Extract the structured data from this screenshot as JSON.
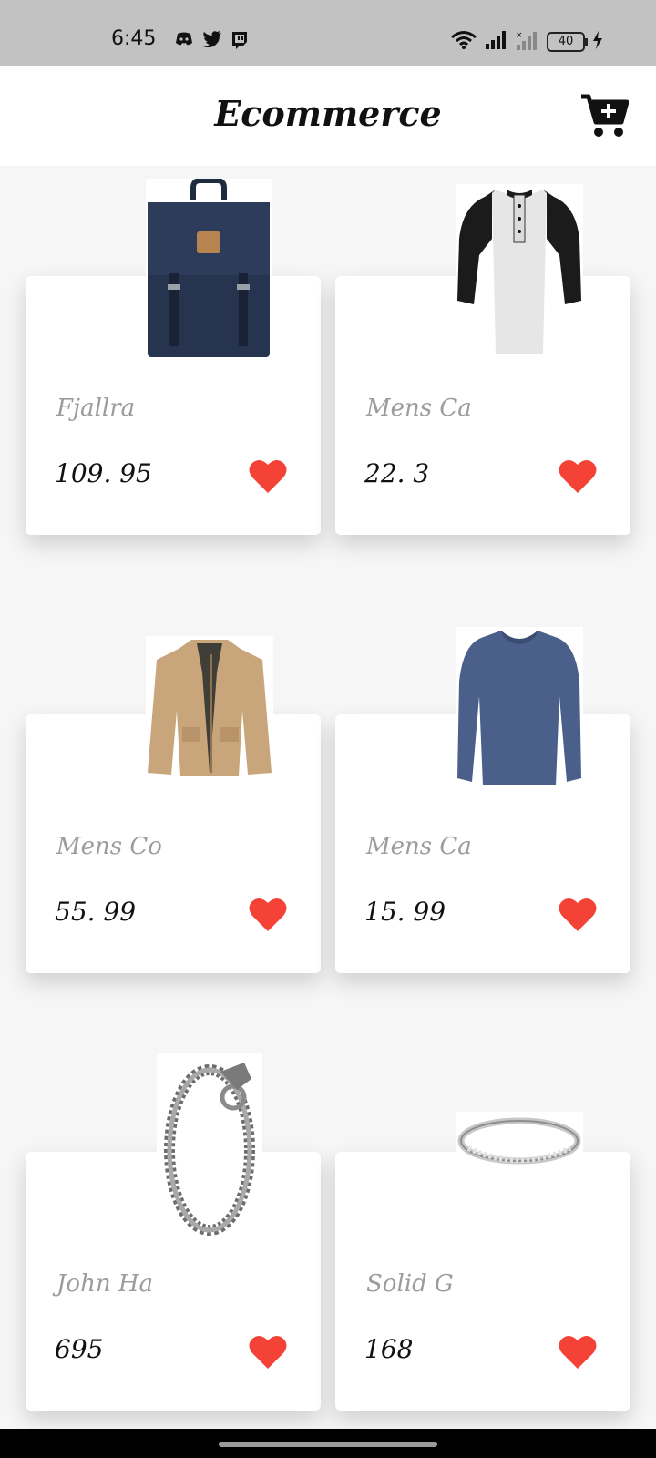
{
  "status_bar": {
    "time": "6:45",
    "battery": "40",
    "app_icons": [
      "discord-icon",
      "twitter-icon",
      "twitch-icon"
    ]
  },
  "app_bar": {
    "title": "Ecommerce",
    "cart_icon": "cart-add-icon"
  },
  "colors": {
    "heart": "#f44336",
    "name_text": "#9c9c9c",
    "price_text": "#111111",
    "background": "#f6f6f6"
  },
  "products": [
    {
      "name": "Fjallra",
      "price": "109. 95",
      "image": "backpack-image"
    },
    {
      "name": "Mens Ca",
      "price": "22. 3",
      "image": "raglan-tshirt-image"
    },
    {
      "name": "Mens Co",
      "price": "55. 99",
      "image": "cotton-jacket-image"
    },
    {
      "name": "Mens Ca",
      "price": "15. 99",
      "image": "slim-fit-tshirt-image"
    },
    {
      "name": "John Ha",
      "price": "695",
      "image": "chain-bracelet-image"
    },
    {
      "name": "Solid G",
      "price": "168",
      "image": "gold-ring-image"
    }
  ]
}
